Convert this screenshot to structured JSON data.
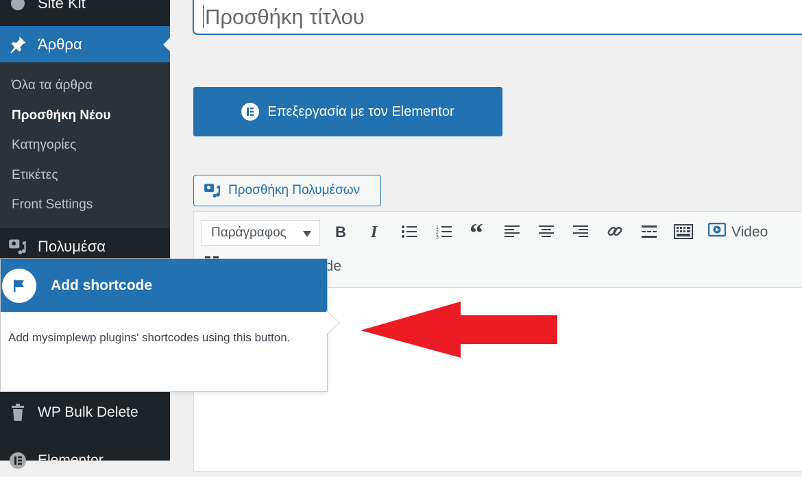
{
  "sidebar": {
    "top_item": "Site Kit",
    "posts": "Άρθρα",
    "submenu": [
      "Όλα τα άρθρα",
      "Προσθήκη Νέου",
      "Κατηγορίες",
      "Ετικέτες",
      "Front Settings"
    ],
    "current_submenu_index": 1,
    "media": "Πολυμέσα",
    "bulk_delete": "WP Bulk Delete",
    "elementor": "Elementor"
  },
  "editor": {
    "title_placeholder": "Προσθήκη τίτλου",
    "elementor_button": "Επεξεργασία με τον Elementor",
    "add_media_button": "Προσθήκη Πολυμέσων",
    "format_select_value": "Παράγραφος",
    "video_button": "Video",
    "shortcode_button_visible": "ode"
  },
  "pointer": {
    "title": "Add shortcode",
    "text": "Add mysimplewp plugins' shortcodes using this button."
  },
  "colors": {
    "admin_bar": "#1d2327",
    "submenu_bg": "#2c3338",
    "accent": "#2271b1",
    "arrow_red": "#ed1c24"
  }
}
